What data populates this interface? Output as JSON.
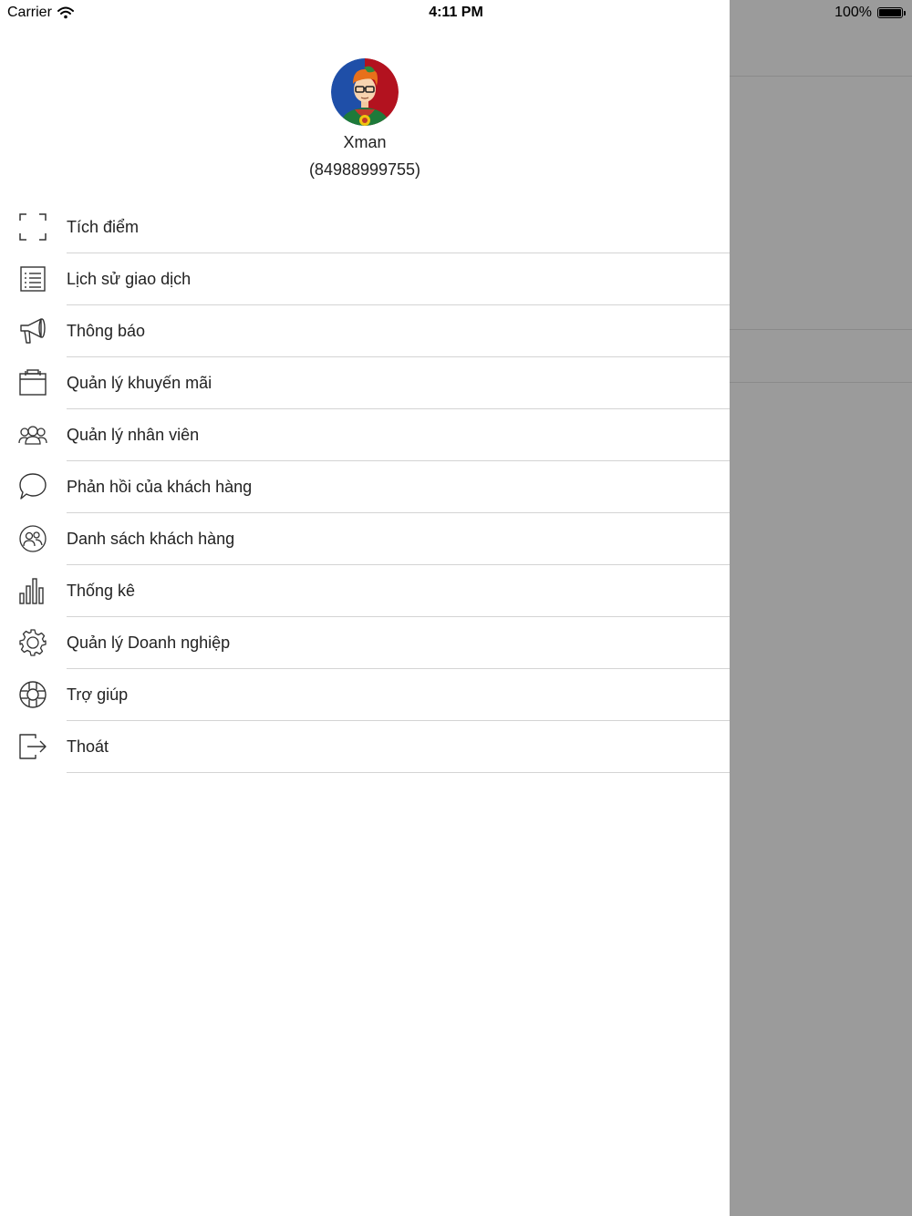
{
  "status_bar": {
    "carrier": "Carrier",
    "time": "4:11 PM",
    "battery": "100%",
    "battery_level": 1.0
  },
  "profile": {
    "name": "Xman",
    "phone": "(84988999755)"
  },
  "menu": {
    "items": [
      {
        "label": "Tích điểm",
        "icon": "scan-frame-icon"
      },
      {
        "label": "Lịch sử giao dịch",
        "icon": "list-document-icon"
      },
      {
        "label": "Thông báo",
        "icon": "megaphone-icon"
      },
      {
        "label": "Quản lý khuyến mãi",
        "icon": "calendar-briefcase-icon"
      },
      {
        "label": "Quản lý nhân viên",
        "icon": "people-group-icon"
      },
      {
        "label": "Phản hồi của khách hàng",
        "icon": "chat-bubble-icon"
      },
      {
        "label": "Danh sách khách hàng",
        "icon": "customers-circle-icon"
      },
      {
        "label": "Thống kê",
        "icon": "bar-chart-icon"
      },
      {
        "label": "Quản lý Doanh nghiệp",
        "icon": "gear-icon"
      },
      {
        "label": "Trợ giúp",
        "icon": "lifebuoy-icon"
      },
      {
        "label": "Thoát",
        "icon": "logout-icon"
      }
    ]
  },
  "colors": {
    "drawer_bg": "#ffffff",
    "backdrop": "#9b9b9b",
    "separator": "#d4d4d4",
    "text": "#222222"
  }
}
